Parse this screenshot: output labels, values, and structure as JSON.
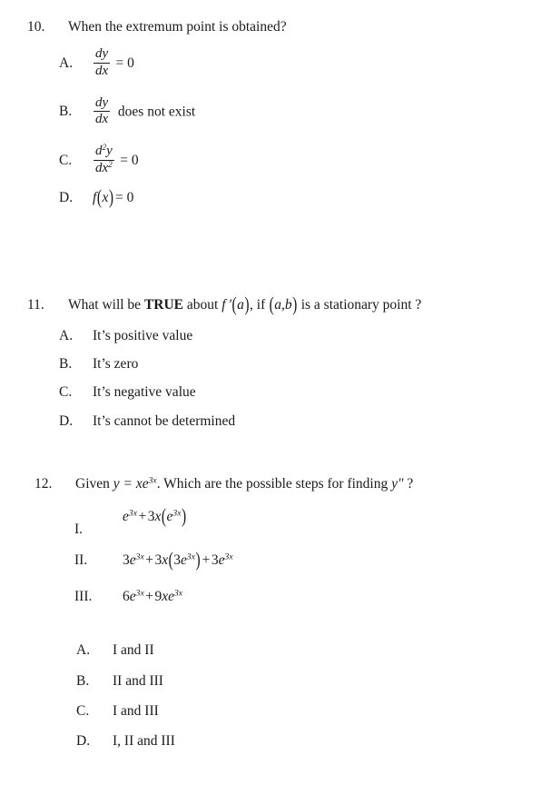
{
  "document": {
    "type": "exam-worksheet",
    "page_background": "#ffffff",
    "text_color": "#1a1a1a"
  },
  "questions": [
    {
      "number": "10.",
      "stem": "When the extremum point is obtained?",
      "options": [
        {
          "label": "A.",
          "kind": "math-fraction",
          "numerator": "dy",
          "denominator": "dx",
          "relation": "= 0",
          "trailing": ""
        },
        {
          "label": "B.",
          "kind": "math-fraction",
          "numerator": "dy",
          "denominator": "dx",
          "relation": "",
          "trailing": "does not exist"
        },
        {
          "label": "C.",
          "kind": "math-fraction",
          "numerator": "d",
          "numerator_sup": "2",
          "numerator_tail": "y",
          "denominator": "dx",
          "denominator_sup": "2",
          "relation": "= 0",
          "trailing": ""
        },
        {
          "label": "D.",
          "kind": "math-function",
          "function": "f",
          "argument": "x",
          "relation": "= 0",
          "text": "f (x) = 0"
        }
      ]
    },
    {
      "number": "11.",
      "stem_part1": "What will be ",
      "stem_bold": "TRUE",
      "stem_part2": " about ",
      "stem_math1": "f '(a)",
      "stem_part3": ", if ",
      "stem_math2": "(a,b)",
      "stem_part4": " is a stationary point ?",
      "options": [
        {
          "label": "A.",
          "text": "It’s positive value"
        },
        {
          "label": "B.",
          "text": "It’s zero"
        },
        {
          "label": "C.",
          "text": "It’s negative value"
        },
        {
          "label": "D.",
          "text": "It’s cannot be determined"
        }
      ]
    },
    {
      "number": "12.",
      "stem_part1": "Given ",
      "stem_math1": "y = xe",
      "stem_math1_sup": "3x",
      "stem_part2": ". Which are the possible steps for finding ",
      "stem_math2": "y\"",
      "stem_part3": " ?",
      "steps": [
        {
          "label": "I.",
          "formula_text": "e^{3x} + 3x(e^{3x})"
        },
        {
          "label": "II.",
          "formula_text": "3e^{3x} + 3x(3e^{3x}) + 3e^{3x}"
        },
        {
          "label": "III.",
          "formula_text": "6e^{3x} + 9xe^{3x}"
        }
      ],
      "options": [
        {
          "label": "A.",
          "text": "I  and II"
        },
        {
          "label": "B.",
          "text": "II and III"
        },
        {
          "label": "C.",
          "text": "I and III"
        },
        {
          "label": "D.",
          "text": "I, II and III"
        }
      ]
    }
  ]
}
